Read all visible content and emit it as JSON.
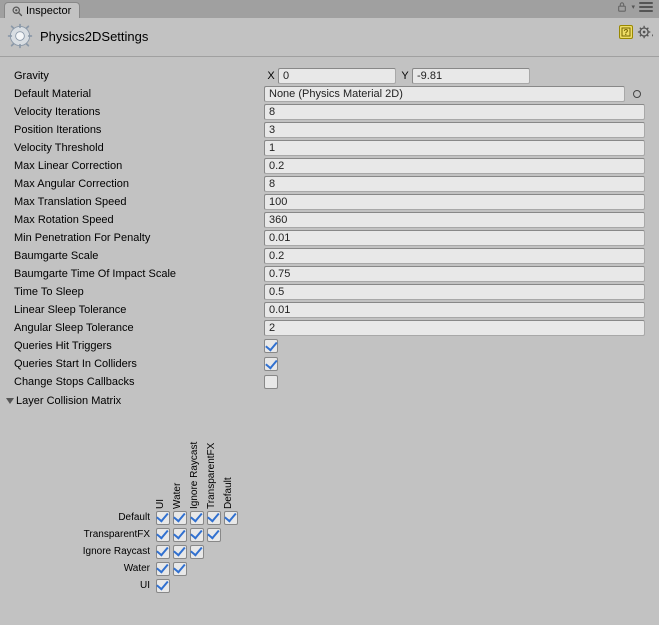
{
  "tab": {
    "label": "Inspector"
  },
  "title": "Physics2DSettings",
  "props": {
    "gravity": {
      "label": "Gravity",
      "x_label": "X",
      "x": "0",
      "y_label": "Y",
      "y": "-9.81"
    },
    "default_material": {
      "label": "Default Material",
      "value": "None (Physics Material 2D)"
    },
    "velocity_iterations": {
      "label": "Velocity Iterations",
      "value": "8"
    },
    "position_iterations": {
      "label": "Position Iterations",
      "value": "3"
    },
    "velocity_threshold": {
      "label": "Velocity Threshold",
      "value": "1"
    },
    "max_linear_correction": {
      "label": "Max Linear Correction",
      "value": "0.2"
    },
    "max_angular_correction": {
      "label": "Max Angular Correction",
      "value": "8"
    },
    "max_translation_speed": {
      "label": "Max Translation Speed",
      "value": "100"
    },
    "max_rotation_speed": {
      "label": "Max Rotation Speed",
      "value": "360"
    },
    "min_penetration": {
      "label": "Min Penetration For Penalty",
      "value": "0.01"
    },
    "baumgarte_scale": {
      "label": "Baumgarte Scale",
      "value": "0.2"
    },
    "baumgarte_toi": {
      "label": "Baumgarte Time Of Impact Scale",
      "value": "0.75"
    },
    "time_to_sleep": {
      "label": "Time To Sleep",
      "value": "0.5"
    },
    "linear_sleep_tol": {
      "label": "Linear Sleep Tolerance",
      "value": "0.01"
    },
    "angular_sleep_tol": {
      "label": "Angular Sleep Tolerance",
      "value": "2"
    },
    "queries_hit_triggers": {
      "label": "Queries Hit Triggers",
      "checked": true
    },
    "queries_start_in_colliders": {
      "label": "Queries Start In Colliders",
      "checked": true
    },
    "change_stops_callbacks": {
      "label": "Change Stops Callbacks",
      "checked": false
    }
  },
  "collision_matrix": {
    "label": "Layer Collision Matrix",
    "layers": [
      "Default",
      "TransparentFX",
      "Ignore Raycast",
      "Water",
      "UI"
    ],
    "matrix": [
      [
        true,
        true,
        true,
        true,
        true
      ],
      [
        true,
        true,
        true,
        true
      ],
      [
        true,
        true,
        true
      ],
      [
        true,
        true
      ],
      [
        true
      ]
    ]
  }
}
